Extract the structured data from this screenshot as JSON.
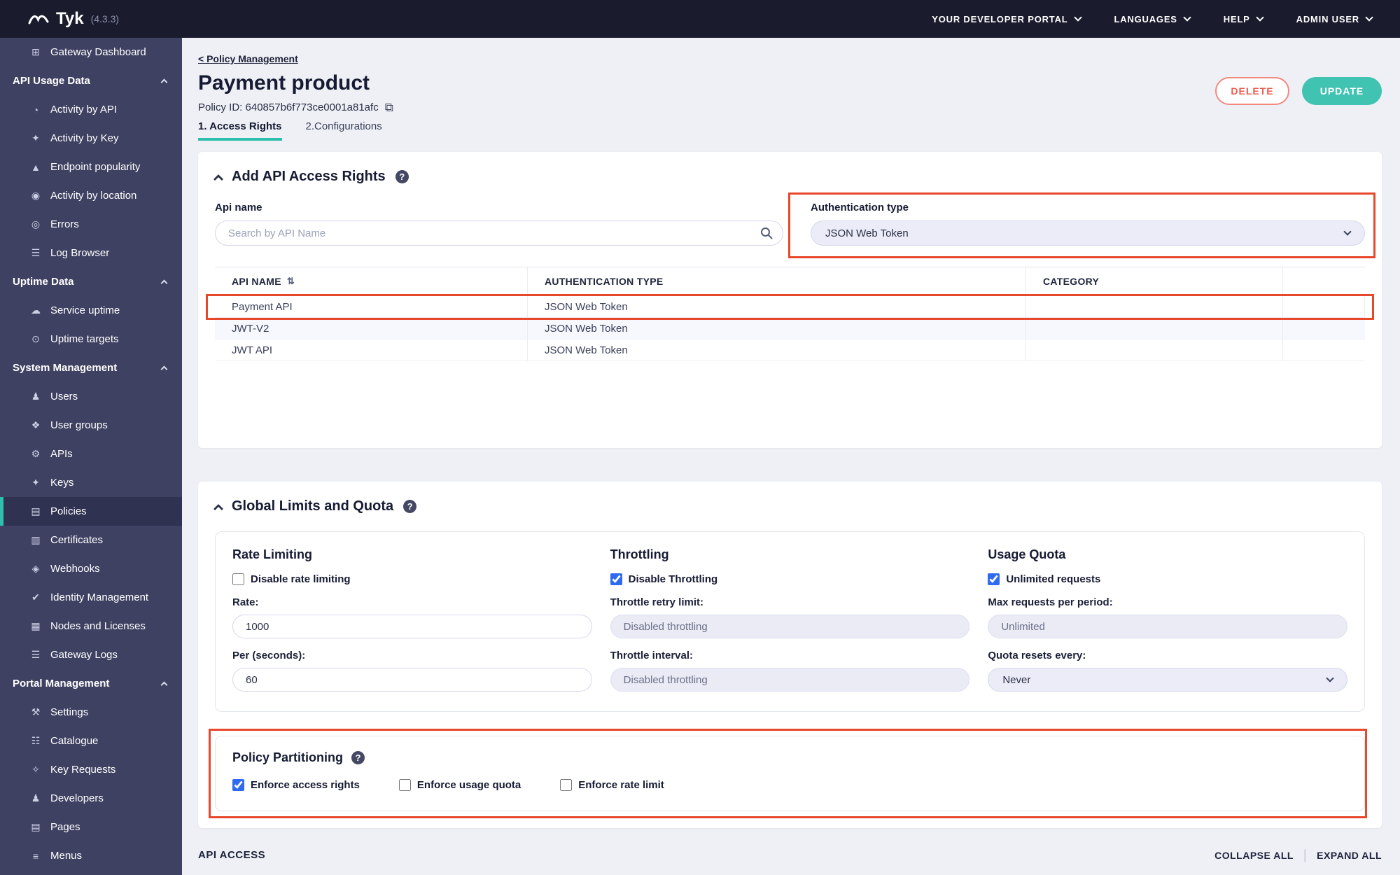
{
  "topbar": {
    "logo_text": "Tyk",
    "version": "(4.3.3)",
    "menus": [
      {
        "label": "YOUR DEVELOPER PORTAL"
      },
      {
        "label": "LANGUAGES"
      },
      {
        "label": "HELP"
      },
      {
        "label": "ADMIN USER"
      }
    ]
  },
  "icons": {
    "help": "?",
    "copy": "⧉",
    "sort": "⇅"
  },
  "sidebar": {
    "items": [
      {
        "label": "Gateway Dashboard",
        "icon": "⊞"
      },
      {
        "label": "API Usage Data",
        "section": true
      },
      {
        "label": "Activity by API",
        "icon": "◔"
      },
      {
        "label": "Activity by Key",
        "icon": "✦"
      },
      {
        "label": "Endpoint popularity",
        "icon": "▲"
      },
      {
        "label": "Activity by location",
        "icon": "◉"
      },
      {
        "label": "Errors",
        "icon": "◎"
      },
      {
        "label": "Log Browser",
        "icon": "☰"
      },
      {
        "label": "Uptime Data",
        "section": true
      },
      {
        "label": "Service uptime",
        "icon": "☁"
      },
      {
        "label": "Uptime targets",
        "icon": "⊙"
      },
      {
        "label": "System Management",
        "section": true
      },
      {
        "label": "Users",
        "icon": "♟"
      },
      {
        "label": "User groups",
        "icon": "❖"
      },
      {
        "label": "APIs",
        "icon": "⚙"
      },
      {
        "label": "Keys",
        "icon": "✦"
      },
      {
        "label": "Policies",
        "icon": "▤",
        "active": true
      },
      {
        "label": "Certificates",
        "icon": "▥"
      },
      {
        "label": "Webhooks",
        "icon": "◈"
      },
      {
        "label": "Identity Management",
        "icon": "✔"
      },
      {
        "label": "Nodes and Licenses",
        "icon": "▦"
      },
      {
        "label": "Gateway Logs",
        "icon": "☰"
      },
      {
        "label": "Portal Management",
        "section": true
      },
      {
        "label": "Settings",
        "icon": "⚒"
      },
      {
        "label": "Catalogue",
        "icon": "☷"
      },
      {
        "label": "Key Requests",
        "icon": "✧"
      },
      {
        "label": "Developers",
        "icon": "♟"
      },
      {
        "label": "Pages",
        "icon": "▤"
      },
      {
        "label": "Menus",
        "icon": "≡"
      }
    ]
  },
  "page": {
    "breadcrumb": "< Policy Management",
    "title": "Payment product",
    "policy_id": "Policy ID: 640857b6f773ce0001a81afc",
    "delete_button": "DELETE",
    "update_button": "UPDATE",
    "tabs": [
      {
        "label": "1. Access Rights",
        "active": true
      },
      {
        "label": "2.Configurations",
        "active": false
      }
    ]
  },
  "access_rights_card": {
    "title": "Add API Access Rights",
    "api_name_label": "Api name",
    "search_placeholder": "Search by API Name",
    "auth_type_label": "Authentication type",
    "auth_type_value": "JSON Web Token",
    "table": {
      "columns": [
        "API NAME",
        "AUTHENTICATION TYPE",
        "CATEGORY"
      ],
      "rows": [
        {
          "api_name": "Payment API",
          "auth_type": "JSON Web Token",
          "category": ""
        },
        {
          "api_name": "JWT-V2",
          "auth_type": "JSON Web Token",
          "category": ""
        },
        {
          "api_name": "JWT API",
          "auth_type": "JSON Web Token",
          "category": ""
        }
      ]
    }
  },
  "limits_card": {
    "title": "Global Limits and Quota",
    "rate_limiting": {
      "title": "Rate Limiting",
      "disable_label": "Disable rate limiting",
      "disable_checked": false,
      "rate_label": "Rate:",
      "rate_value": "1000",
      "per_label": "Per (seconds):",
      "per_value": "60"
    },
    "throttling": {
      "title": "Throttling",
      "disable_label": "Disable Throttling",
      "disable_checked": true,
      "retry_label": "Throttle retry limit:",
      "retry_value": "Disabled throttling",
      "interval_label": "Throttle interval:",
      "interval_value": "Disabled throttling"
    },
    "usage_quota": {
      "title": "Usage Quota",
      "unlimited_label": "Unlimited requests",
      "unlimited_checked": true,
      "max_label": "Max requests per period:",
      "max_value": "Unlimited",
      "resets_label": "Quota resets every:",
      "resets_value": "Never"
    },
    "policy_partitioning": {
      "title": "Policy Partitioning",
      "options": [
        {
          "label": "Enforce access rights",
          "checked": true
        },
        {
          "label": "Enforce usage quota",
          "checked": false
        },
        {
          "label": "Enforce rate limit",
          "checked": false
        }
      ]
    }
  },
  "footer": {
    "api_access": "API ACCESS",
    "collapse_all": "COLLAPSE ALL",
    "expand_all": "EXPAND ALL"
  },
  "colors": {
    "teal_accent": "#2fbfad",
    "annotation_red": "#e8492c",
    "delete_red": "#ef5a4e",
    "topbar_bg": "#1a1c2e",
    "sidebar_bg": "#3f4162",
    "checkbox_blue": "#2e6bf0"
  }
}
